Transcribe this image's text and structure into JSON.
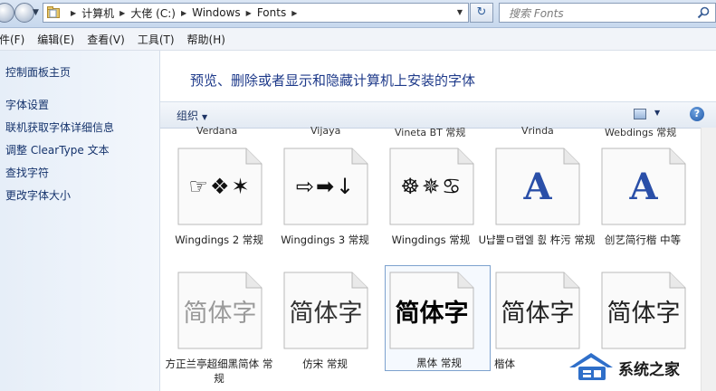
{
  "address_bar": {
    "breadcrumbs": [
      "计算机",
      "大佬 (C:)",
      "Windows",
      "Fonts"
    ]
  },
  "search": {
    "placeholder": "搜索 Fonts"
  },
  "menu": [
    "件(F)",
    "编辑(E)",
    "查看(V)",
    "工具(T)",
    "帮助(H)"
  ],
  "navpane": {
    "home": "控制面板主页",
    "links": [
      "字体设置",
      "联机获取字体详细信息",
      "调整 ClearType 文本",
      "查找字符",
      "更改字体大小"
    ]
  },
  "content": {
    "heading": "预览、删除或者显示和隐藏计算机上安装的字体",
    "organize": "组织"
  },
  "fonts_top_row": [
    "Verdana",
    "Vijaya",
    "Vineta BT 常规",
    "Vrinda",
    "Webdings 常规"
  ],
  "fonts_row1": [
    {
      "name": "Wingdings 2 常规",
      "preview": "☞❖✶",
      "kind": "symbol"
    },
    {
      "name": "Wingdings 3 常规",
      "preview": "⇨➡↓",
      "kind": "symbol"
    },
    {
      "name": "Wingdings 常规",
      "preview": "☸✵♋",
      "kind": "symbol"
    },
    {
      "name": "U냡뿔ㅁ랩엘 흸 杵污 常规",
      "preview": "A",
      "kind": "letter"
    },
    {
      "name": "创艺简行楷 中等",
      "preview": "A",
      "kind": "letter"
    }
  ],
  "fonts_row2": [
    {
      "name": "方正兰亭超细黑简体 常规",
      "preview": "简体字",
      "kind": "cjk-light"
    },
    {
      "name": "仿宋 常规",
      "preview": "简体字",
      "kind": "cjk"
    },
    {
      "name": "黑体 常规",
      "preview": "简体字",
      "kind": "cjk-bold",
      "selected": true
    },
    {
      "name": "楷体",
      "preview": "简体字",
      "kind": "cjk"
    },
    {
      "name": "",
      "preview": "简体字",
      "kind": "cjk"
    }
  ],
  "watermark": {
    "text": "系统之家"
  },
  "colors": {
    "link": "#15336c",
    "heading": "#1e3a8a",
    "accent": "#2a4fa8"
  }
}
